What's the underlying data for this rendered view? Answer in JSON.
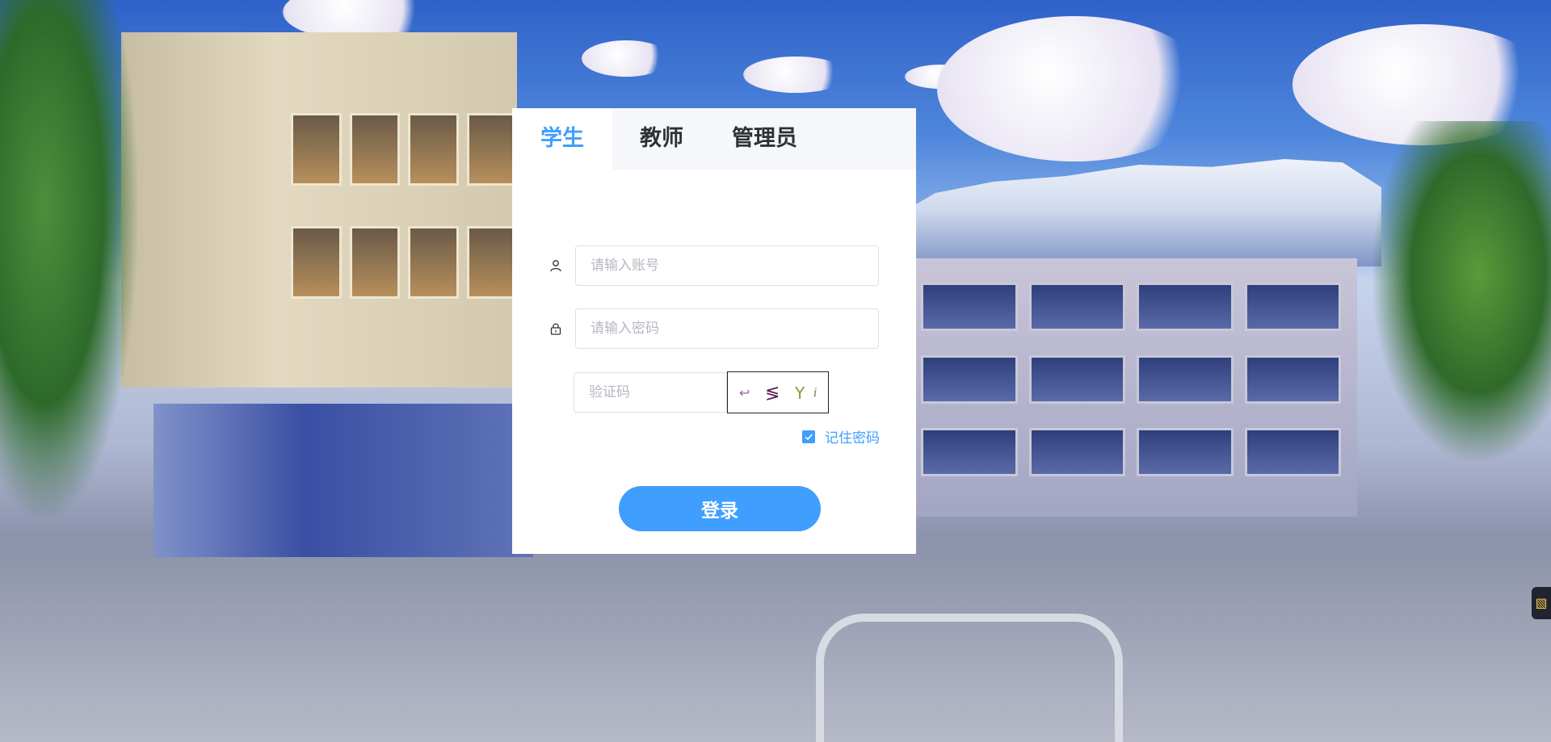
{
  "tabs": [
    {
      "label": "学生",
      "active": true
    },
    {
      "label": "教师",
      "active": false
    },
    {
      "label": "管理员",
      "active": false
    }
  ],
  "form": {
    "account": {
      "placeholder": "请输入账号",
      "value": "",
      "icon": "user-icon"
    },
    "password": {
      "placeholder": "请输入密码",
      "value": "",
      "icon": "lock-icon"
    },
    "captcha": {
      "placeholder": "验证码",
      "value": "",
      "image_text": "↩ ≶ Y i"
    },
    "remember": {
      "label": "记住密码",
      "checked": true
    },
    "submit_label": "登录"
  },
  "colors": {
    "accent": "#409eff",
    "tab_bar": "#f5f7fa",
    "text": "#303133"
  },
  "side_widget": {
    "icon": "clipboard-icon"
  }
}
